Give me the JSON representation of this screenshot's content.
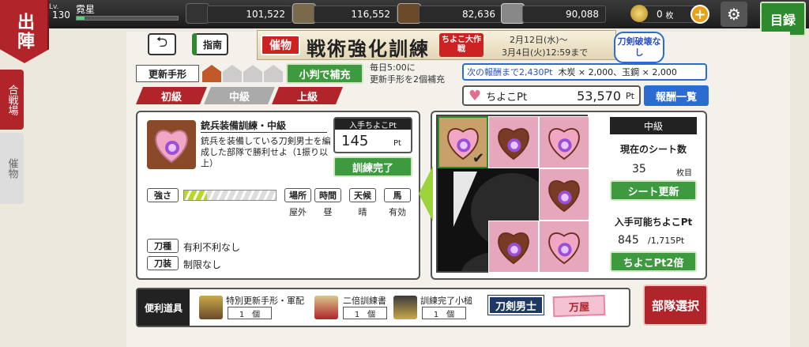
{
  "header": {
    "badge": "出陣",
    "level_label": "Lv.",
    "level": "130",
    "player_name": "霓星",
    "exp_fraction": 0.08
  },
  "resources": [
    {
      "name": "charcoal",
      "value": "101,522"
    },
    {
      "name": "steel",
      "value": "116,552"
    },
    {
      "name": "cooling-water",
      "value": "82,636"
    },
    {
      "name": "whetstone",
      "value": "90,088"
    }
  ],
  "coins": {
    "value": "0",
    "unit": "枚"
  },
  "nav": {
    "menu_label": "目録",
    "side_tabs": [
      "合戦場",
      "催物"
    ]
  },
  "controls": {
    "guide_label": "指南"
  },
  "event": {
    "tag": "催物",
    "title": "戦術強化訓練",
    "sub": "ちよこ大作戦",
    "date_start": "2月12日(水)～",
    "date_end": "3月4日(火)12:59まで",
    "badge": "刀剣破壊なし"
  },
  "renew": {
    "label": "更新手形",
    "button": "小判で補充",
    "info_line1": "毎日5:00に",
    "info_line2": "更新手形を2個補充"
  },
  "next_reward": {
    "prefix": "次の報酬まで2,430Pt",
    "rest": "木炭 × 2,000、玉鋼 × 2,000"
  },
  "difficulty": {
    "tabs": [
      "初級",
      "中級",
      "上級"
    ],
    "selected": 1
  },
  "points": {
    "label": "ちよこPt",
    "value": "53,570",
    "unit": "Pt",
    "reward_button": "報酬一覧"
  },
  "task": {
    "title": "銃兵装備訓練・中級",
    "desc": "銃兵を装備している刀剣男士を編成した部隊で勝利せよ（1振り以上）",
    "pt_header": "入手ちよこPt",
    "pt_value": "145",
    "pt_unit": "Pt",
    "done_button": "訓練完了",
    "strength_label": "強さ",
    "strength_fraction": 0.25,
    "conditions": [
      {
        "label": "場所",
        "value": "屋外"
      },
      {
        "label": "時間",
        "value": "昼"
      },
      {
        "label": "天候",
        "value": "晴"
      },
      {
        "label": "馬",
        "value": "有効"
      }
    ],
    "attrs": [
      {
        "label": "刀種",
        "value": "有利不利なし"
      },
      {
        "label": "刀装",
        "value": "制限なし"
      }
    ]
  },
  "sheet": {
    "level": "中級",
    "count_label": "現在のシート数",
    "count": "35",
    "count_unit": "枚目",
    "refresh_button": "シート更新",
    "avail_label": "入手可能ちよこPt",
    "avail_value": "845",
    "avail_max": "/1,715Pt",
    "double_button": "ちよこPt2倍",
    "check_mark": "✔"
  },
  "tools": {
    "label": "便利道具",
    "items": [
      {
        "name": "特別更新手形・軍配",
        "count": "1　個"
      },
      {
        "name": "二倍訓練書",
        "count": "1　個"
      },
      {
        "name": "訓練完了小槌",
        "count": "1　個"
      }
    ],
    "touken_button": "刀剣男士",
    "yorozuya_button": "万屋",
    "butai_button": "部隊選択"
  }
}
